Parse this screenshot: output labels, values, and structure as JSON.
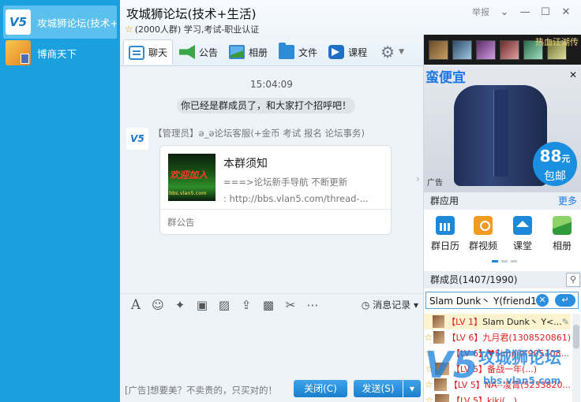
{
  "sidebar": {
    "conversations": [
      {
        "label": "攻城狮论坛(技术+..."
      },
      {
        "label": "博商天下"
      }
    ]
  },
  "header": {
    "title": "攻城狮论坛(技术+生活)",
    "info": "(2000人群) 学习,考试-职业认证",
    "report_label": "举报",
    "tabs": [
      {
        "label": "聊天",
        "icon": "chat-icon"
      },
      {
        "label": "公告",
        "icon": "notice-icon"
      },
      {
        "label": "相册",
        "icon": "album-icon"
      },
      {
        "label": "文件",
        "icon": "folder-icon"
      },
      {
        "label": "课程",
        "icon": "course-icon"
      }
    ]
  },
  "chat": {
    "timestamp": "15:04:09",
    "system_message": "你已经是群成员了，和大家打个招呼吧！",
    "sender": "【管理员】ə_ə论坛客服(+金币 考试 报名 论坛事务)",
    "card": {
      "thumb_title": "欢迎加入",
      "thumb_url": "bbs.vlan5.com",
      "title": "本群须知",
      "line1": "===>论坛新手导航 不断更新",
      "line2": ":   http://bbs.vlan5.com/thread-...",
      "footer": "群公告"
    }
  },
  "toolbar": {
    "history_label": "消息记录"
  },
  "bottom": {
    "ad_text": "[广告]想要美？不卖贵的，只买对的！",
    "close_label": "关闭(C)",
    "send_label": "发送(S)"
  },
  "right": {
    "game_title": "热血江湖传",
    "ad": {
      "headline": "蛮便宜",
      "price": "88",
      "price_unit": "元",
      "shipping": "包邮",
      "tag": "广告"
    },
    "apps_title": "群应用",
    "apps_more": "更多",
    "apps": [
      {
        "label": "群日历",
        "icon": "calendar-icon"
      },
      {
        "label": "群视频",
        "icon": "video-icon"
      },
      {
        "label": "课堂",
        "icon": "classroom-icon"
      },
      {
        "label": "相册",
        "icon": "album-icon"
      }
    ],
    "members_title": "群成员(1407/1990)",
    "search_value": "Slam Dunk丶 Y(friend13",
    "members": [
      {
        "level": "【LV 1】",
        "name": "Slam Dunk丶 Y<..."
      },
      {
        "level": "【LV 6】",
        "name": "九月君(1308520861)"
      },
      {
        "level": "【LV 6】",
        "name": "♥Simple(905108..."
      },
      {
        "level": "【LV 5】",
        "name": "备战一年(...)"
      },
      {
        "level": "【LV 5】",
        "name": "NA--凌霄(5233820..."
      },
      {
        "level": "【LV 5】",
        "name": "kiki(...)"
      }
    ]
  },
  "watermark": {
    "logo": "V5",
    "title": "攻城狮论坛",
    "url": "bbs.vlan5.com"
  },
  "colors": {
    "sidebar": "#1aa0de",
    "accent": "#1b80cc",
    "level_red": "#e02020"
  }
}
